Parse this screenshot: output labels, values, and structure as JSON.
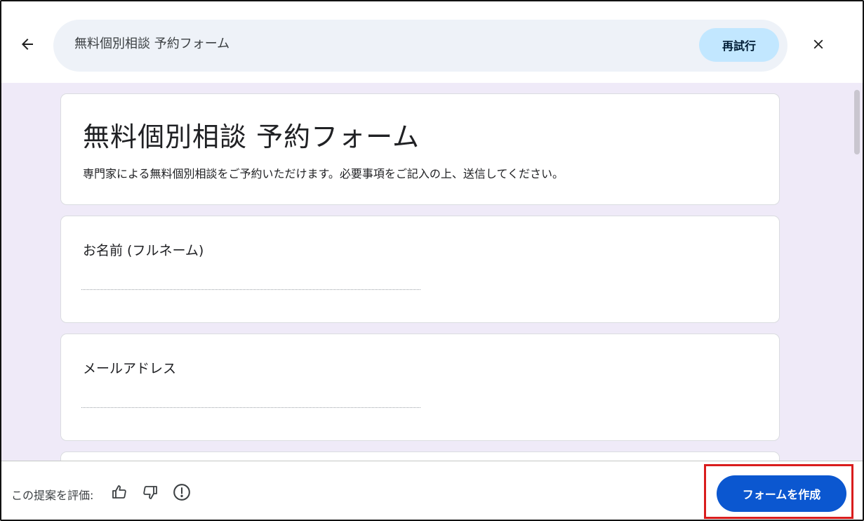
{
  "header": {
    "prompt_text": "無料個別相談 予約フォーム",
    "retry_label": "再試行",
    "back_icon": "arrow-left-icon",
    "close_icon": "close-icon"
  },
  "form": {
    "title": "無料個別相談 予約フォーム",
    "description": "専門家による無料個別相談をご予約いただけます。必要事項をご記入の上、送信してください。",
    "questions": [
      {
        "label": "お名前 (フルネーム)"
      },
      {
        "label": "メールアドレス"
      }
    ]
  },
  "footer": {
    "rate_label": "この提案を評価:",
    "thumbs_up_icon": "thumbs-up-icon",
    "thumbs_down_icon": "thumbs-down-icon",
    "report_icon": "alert-circle-icon",
    "create_label": "フォームを作成"
  },
  "colors": {
    "preview_background": "#efeaf8",
    "prompt_bar": "#eef2f8",
    "retry_button": "#c2e7ff",
    "create_button": "#0b57d0",
    "highlight": "#d91d1d"
  }
}
